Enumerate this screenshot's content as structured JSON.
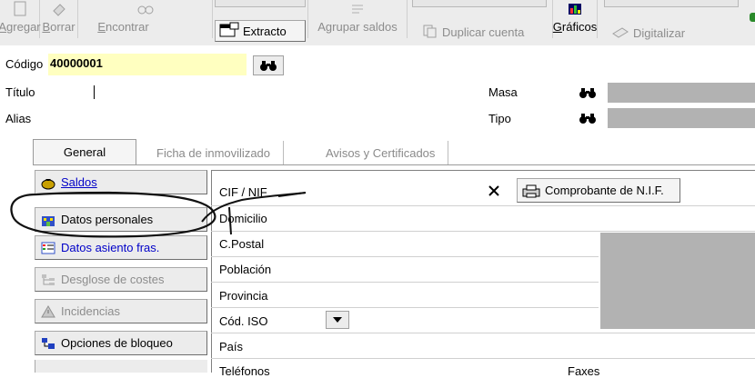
{
  "toolbar": {
    "buttons": [
      {
        "label": "Agregar",
        "hotkey": "A",
        "rest": "gregar"
      },
      {
        "label": "Borrar",
        "hotkey": "B",
        "rest": "orrar"
      },
      {
        "label": "Encontrar",
        "hotkey": "E",
        "rest": "ncontrar"
      }
    ],
    "extracto": "Extracto",
    "agrupar_saldos": "Agrupar saldos",
    "duplicar_cuenta": "Duplicar cuenta",
    "graficos": {
      "hotkey": "G",
      "rest": "ráficos"
    },
    "digitalizar": "Digitalizar"
  },
  "form": {
    "codigo_label": "Código",
    "codigo_value": "40000001",
    "titulo_label": "Título",
    "alias_label": "Alias",
    "masa_label": "Masa",
    "tipo_label": "Tipo"
  },
  "tabs": [
    "General",
    "Ficha de inmovilizado",
    "Avisos y Certificados"
  ],
  "side_panel": [
    {
      "label": "Saldos",
      "state": "link",
      "icon": "moneybag-icon"
    },
    {
      "label": "Datos personales",
      "state": "normal",
      "icon": "building-icon"
    },
    {
      "label": "Datos asiento fras.",
      "state": "link",
      "icon": "ledger-icon"
    },
    {
      "label": "Desglose de costes",
      "state": "disabled",
      "icon": "tree-icon"
    },
    {
      "label": "Incidencias",
      "state": "disabled",
      "icon": "warning-icon"
    },
    {
      "label": "Opciones de bloqueo",
      "state": "normal",
      "icon": "lock-icon"
    }
  ],
  "detail": {
    "cif_label": "CIF / NIF",
    "comprobante_label": "Comprobante de N.I.F.",
    "domicilio_label": "Domicilio",
    "cpostal_label": "C.Postal",
    "poblacion_label": "Población",
    "provincia_label": "Provincia",
    "codiso_label": "Cód. ISO",
    "pais_label": "País",
    "telefonos_label": "Teléfonos",
    "faxes_label": "Faxes"
  },
  "colors": {
    "highlight_yellow": "#ffffc0",
    "link_blue": "#0000c8",
    "annotation": "#000000"
  }
}
